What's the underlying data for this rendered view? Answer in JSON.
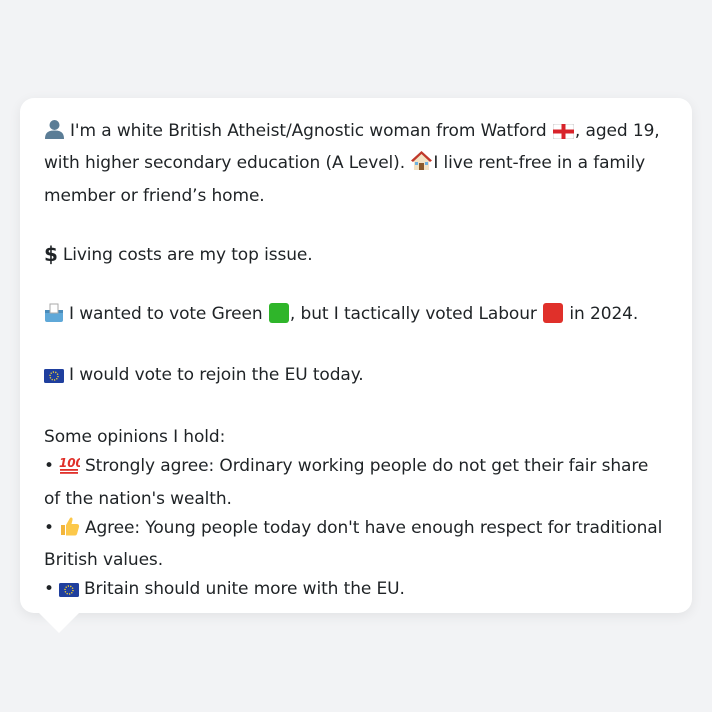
{
  "profile": {
    "line1_a": "I'm a white British Atheist/Agnostic woman from Watford",
    "line1_b": ", aged 19, with higher secondary education (A Level).",
    "line1_c": "I live rent-free in a family member or friend’s home."
  },
  "issue": {
    "text": "Living costs are my top issue."
  },
  "vote": {
    "part_a": "I wanted to vote Green",
    "part_b": ", but I tactically voted Labour",
    "part_c": "in 2024.",
    "green_color": "#2fb52a",
    "labour_color": "#e0302a"
  },
  "eu": {
    "text": "I would vote to rejoin the EU today."
  },
  "opinions": {
    "heading": "Some opinions I hold:",
    "items": [
      {
        "bullet": "•",
        "icon": "hundred-points-icon",
        "text": "Strongly agree: Ordinary working people do not get their fair share of the nation's wealth."
      },
      {
        "bullet": "•",
        "icon": "thumbs-up-icon",
        "text": "Agree: Young people today don't have enough respect for traditional British values."
      },
      {
        "bullet": "•",
        "icon": "eu-flag-icon",
        "text": "Britain should unite more with the EU."
      }
    ]
  }
}
